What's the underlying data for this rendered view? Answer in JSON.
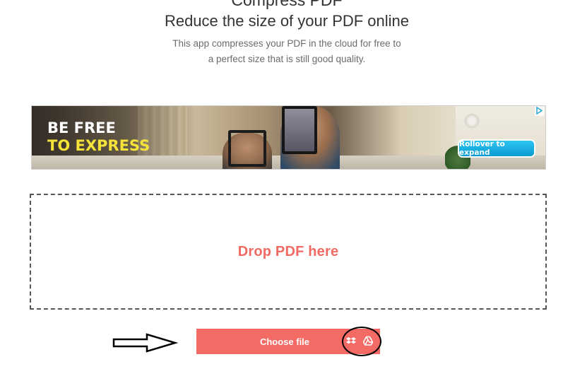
{
  "header": {
    "title": "Compress PDF",
    "subtitle": "Reduce the size of your PDF online",
    "description_line1": "This app compresses your PDF in the cloud for free to",
    "description_line2": "a perfect size that is still good quality."
  },
  "ad": {
    "headline_line1": "BE FREE",
    "headline_line2": "TO EXPRESS",
    "rollover_label": "Rollover to expand",
    "choices_icon": "adchoices-icon"
  },
  "dropzone": {
    "label": "Drop PDF here"
  },
  "upload": {
    "choose_file_label": "Choose file",
    "sources": [
      {
        "name": "Dropbox",
        "icon": "dropbox-icon"
      },
      {
        "name": "Google Drive",
        "icon": "google-drive-icon"
      }
    ]
  },
  "colors": {
    "accent": "#f46b66",
    "drop_label": "#f06a63",
    "ad_yellow": "#f5e33a",
    "ad_button": "#0a9ad0"
  }
}
